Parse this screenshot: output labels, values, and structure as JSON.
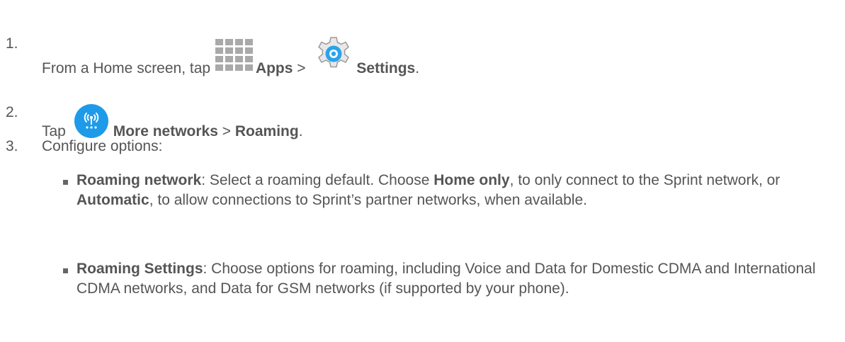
{
  "steps": [
    {
      "number": "1.",
      "text_before": "From a Home screen, tap",
      "apps_label": "Apps",
      "separator": ">",
      "settings_label": "Settings",
      "period": "."
    },
    {
      "number": "2.",
      "text_before": "Tap",
      "more_networks_label": "More networks",
      "separator": ">",
      "roaming_label": "Roaming",
      "period": "."
    },
    {
      "number": "3.",
      "text": "Configure options:"
    }
  ],
  "options": [
    {
      "title": "Roaming network",
      "t1": ": Select a roaming default. Choose ",
      "b1": "Home only",
      "t2": ", to only connect to the Sprint network, or ",
      "b2": "Automatic",
      "t3": ", to allow connections to Sprint’s partner networks, when available."
    },
    {
      "title": "Roaming Settings",
      "t1": ": Choose options for roaming, including Voice and Data for Domestic CDMA and International CDMA networks, and Data for GSM networks (if supported by your phone)."
    }
  ],
  "icons": {
    "apps": "apps-grid-icon",
    "settings": "settings-gear-icon",
    "more_networks": "more-networks-icon"
  },
  "colors": {
    "text": "#555555",
    "apps_icon": "#a9a9a9",
    "network_blue": "#1e9be8",
    "gear_blue": "#2aa3ea"
  }
}
